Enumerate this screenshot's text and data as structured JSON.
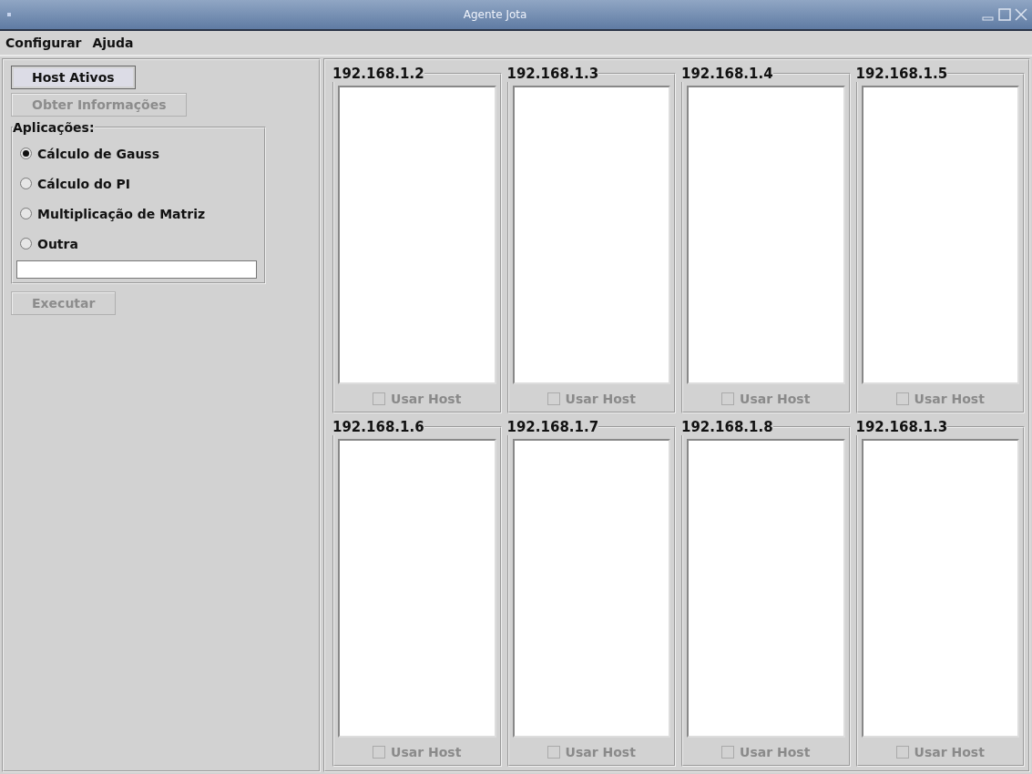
{
  "window": {
    "title": "Agente Jota"
  },
  "menu": [
    {
      "label": "Configurar"
    },
    {
      "label": "Ajuda"
    }
  ],
  "sidebar": {
    "buttons": [
      {
        "label": "Host Ativos",
        "disabled": false,
        "focused": true
      },
      {
        "label": "Obter Informações",
        "disabled": true,
        "focused": false
      }
    ],
    "applications": {
      "title": "Aplicações:",
      "options": [
        {
          "label": "Cálculo de Gauss",
          "selected": true
        },
        {
          "label": "Cálculo do PI",
          "selected": false
        },
        {
          "label": "Multiplicação de Matriz",
          "selected": false
        },
        {
          "label": "Outra",
          "selected": false
        }
      ]
    },
    "run_button": {
      "label": "Executar",
      "disabled": true
    }
  },
  "hosts": [
    {
      "address": "192.168.1.2",
      "use_host": {
        "label": "Usar Host",
        "checked": false,
        "disabled": true
      }
    },
    {
      "address": "192.168.1.3",
      "use_host": {
        "label": "Usar Host",
        "checked": false,
        "disabled": true
      }
    },
    {
      "address": "192.168.1.4",
      "use_host": {
        "label": "Usar Host",
        "checked": false,
        "disabled": true
      }
    },
    {
      "address": "192.168.1.5",
      "use_host": {
        "label": "Usar Host",
        "checked": false,
        "disabled": true
      }
    },
    {
      "address": "192.168.1.6",
      "use_host": {
        "label": "Usar Host",
        "checked": false,
        "disabled": true
      }
    },
    {
      "address": "192.168.1.7",
      "use_host": {
        "label": "Usar Host",
        "checked": false,
        "disabled": true
      }
    },
    {
      "address": "192.168.1.8",
      "use_host": {
        "label": "Usar Host",
        "checked": false,
        "disabled": true
      }
    },
    {
      "address": "192.168.1.3",
      "use_host": {
        "label": "Usar Host",
        "checked": false,
        "disabled": true
      }
    }
  ]
}
